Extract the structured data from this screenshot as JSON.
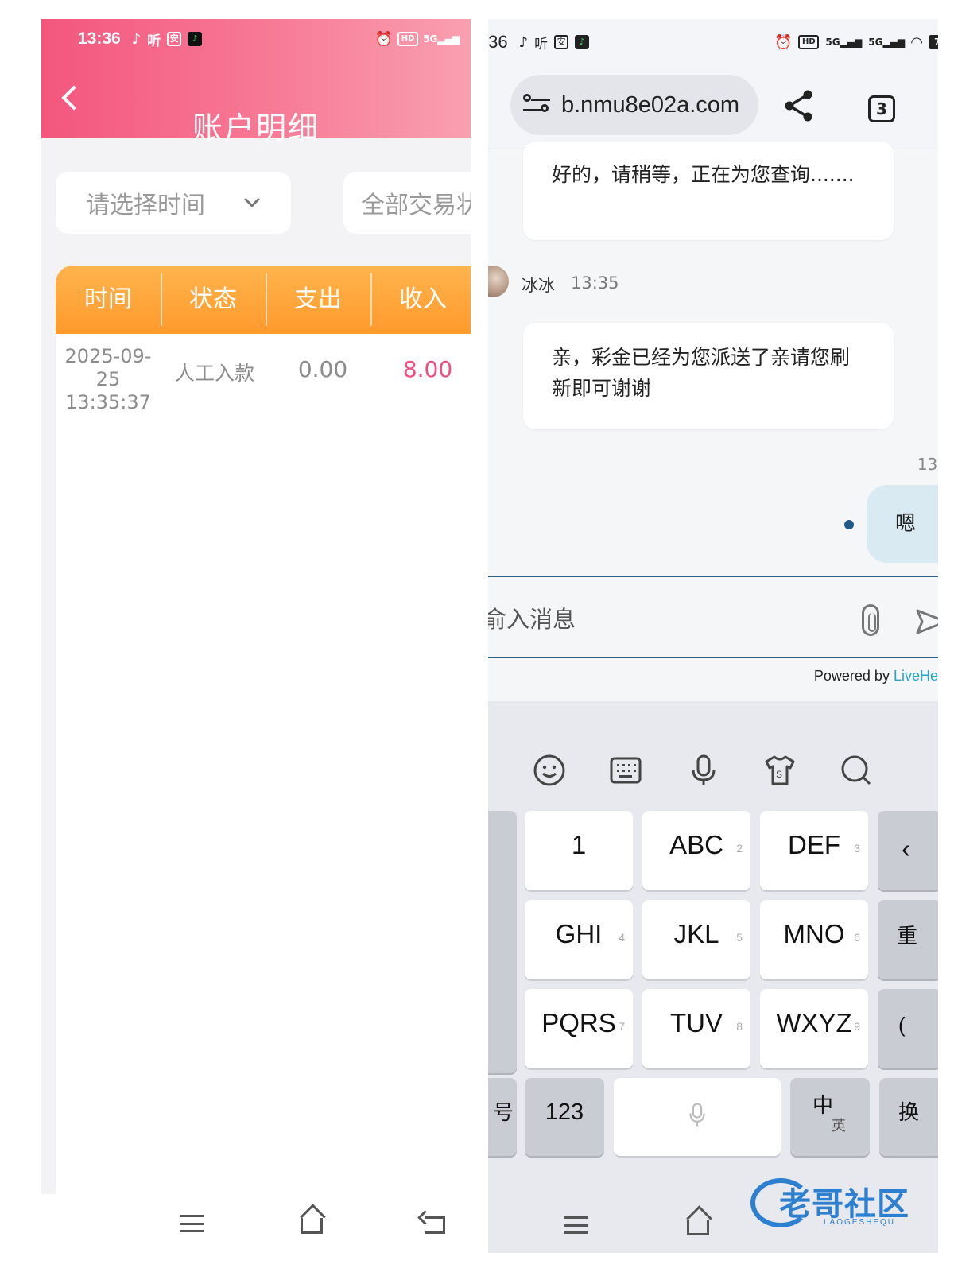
{
  "left": {
    "status_time": "13:36",
    "status_icons": [
      "tiktok-icon",
      "listen-icon",
      "app-icon",
      "green-app-icon"
    ],
    "status_right": [
      "alarm-icon",
      "hd-icon",
      "signal-5g-icon"
    ],
    "title": "账户明细",
    "filter_time": "请选择时间",
    "filter_type": "全部交易状",
    "columns": [
      "时间",
      "状态",
      "支出",
      "收入"
    ],
    "rows": [
      {
        "date": "2025-09-25",
        "time": "13:35:37",
        "status": "人工入款",
        "out": "0.00",
        "in": "8.00"
      }
    ],
    "colors": {
      "header": "#f4567e",
      "table_header": "#ff9a2c",
      "income": "#ee4f7e"
    }
  },
  "right": {
    "status_time": ":36",
    "status_right": [
      "alarm-icon",
      "hd-icon",
      "5g-signal-icon",
      "5g-signal-icon",
      "wifi-icon",
      "battery-icon"
    ],
    "battery": "7",
    "url": "b.nmu8e02a.com",
    "tab_count": "3",
    "chat": {
      "msg1": "好的，请稍等，正在为您查询.......",
      "agent_name": "冰冰",
      "agent_time": "13:35",
      "msg2": "亲，彩金已经为您派送了亲请您刷新即可谢谢",
      "my_time": "13:",
      "my_msg": "嗯"
    },
    "input_placeholder": "俞入消息",
    "powered_prefix": "Powered by",
    "powered_brand": "LiveHel",
    "keyboard": {
      "tools": [
        "emoji-icon",
        "keyboard-icon",
        "mic-icon",
        "shirt-icon",
        "search-icon"
      ],
      "row1": [
        {
          "label": "1",
          "sup": ""
        },
        {
          "label": "ABC",
          "sup": "2"
        },
        {
          "label": "DEF",
          "sup": "3"
        }
      ],
      "row2": [
        {
          "label": "GHI",
          "sup": "4"
        },
        {
          "label": "JKL",
          "sup": "5"
        },
        {
          "label": "MNO",
          "sup": "6"
        }
      ],
      "row3": [
        {
          "label": "PQRS",
          "sup": "7"
        },
        {
          "label": "TUV",
          "sup": "8"
        },
        {
          "label": "WXYZ",
          "sup": "9"
        }
      ],
      "side_right": [
        "重",
        "("
      ],
      "left_bottom": "号",
      "num_key": "123",
      "lang_main": "中",
      "lang_sub": "英",
      "switch_key": "换"
    }
  },
  "watermark": {
    "text": "老哥社区",
    "sub": "LAOGESHEQU"
  }
}
